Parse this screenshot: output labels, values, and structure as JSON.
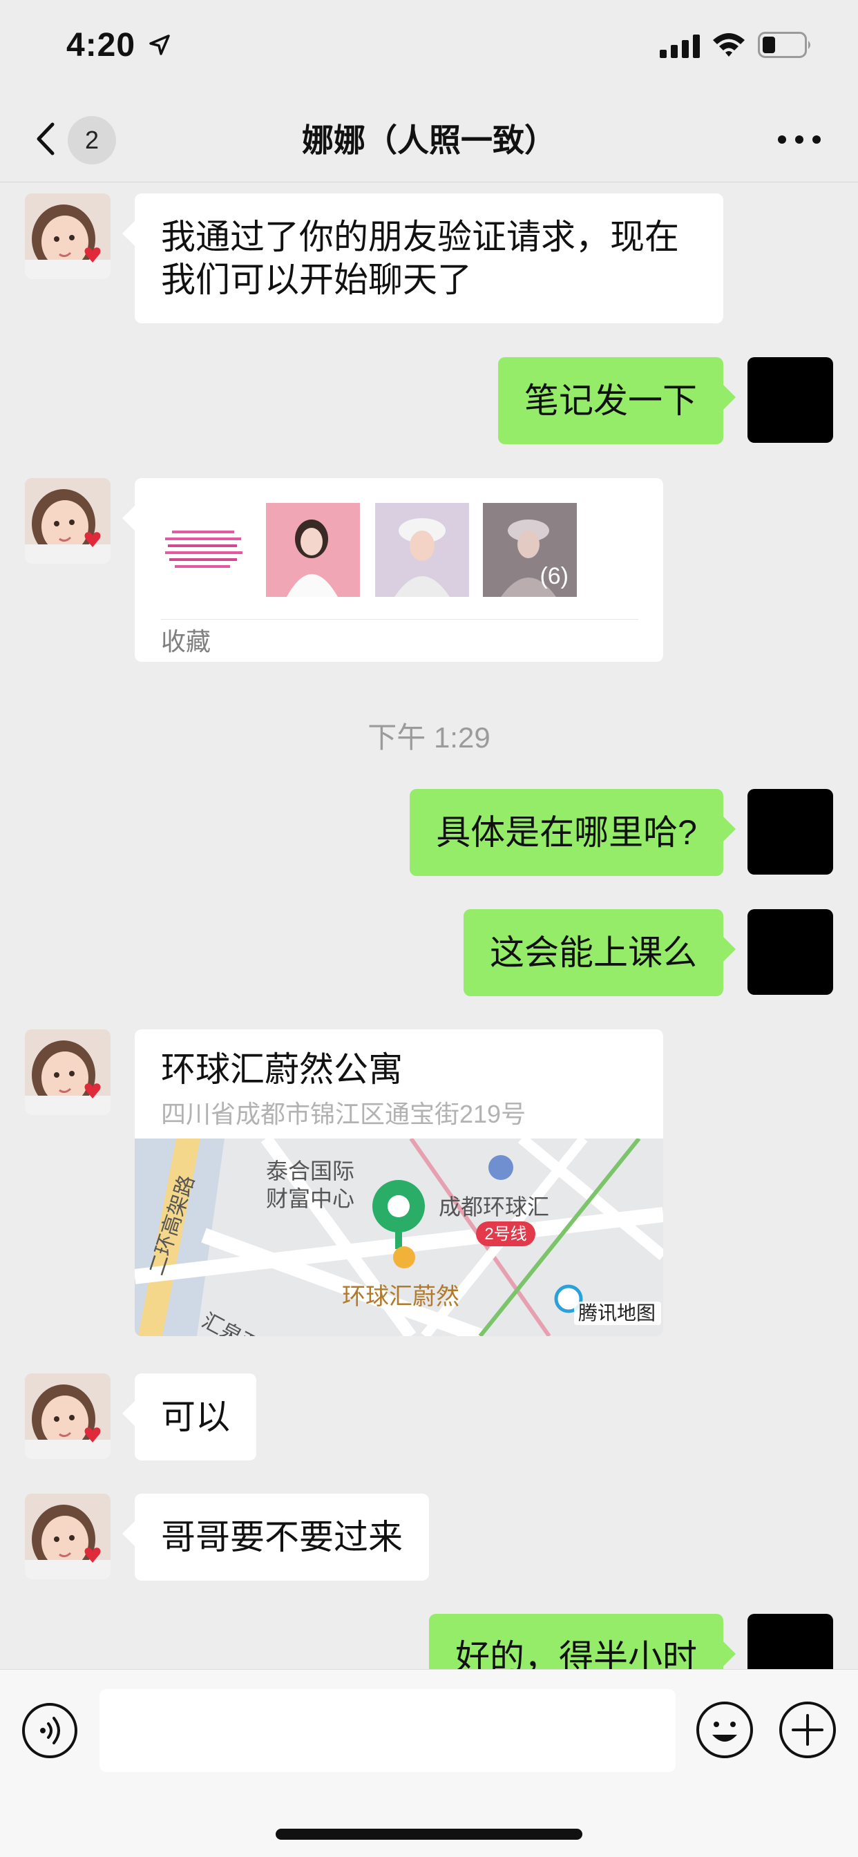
{
  "status_bar": {
    "time": "4:20",
    "icons": [
      "location-arrow-icon",
      "cellular-signal-icon",
      "wifi-icon",
      "battery-icon"
    ]
  },
  "nav": {
    "back_icon": "chevron-left-icon",
    "unread_count": "2",
    "title": "娜娜（人照一致）",
    "more_icon": "more-dots-icon"
  },
  "messages": {
    "m1": {
      "direction": "incoming",
      "text": "我通过了你的朋友验证请求，现在我们可以开始聊天了"
    },
    "m2": {
      "direction": "outgoing",
      "text": "笔记发一下"
    },
    "m3": {
      "direction": "incoming",
      "type": "favorites-card",
      "thumb_count": "(6)",
      "label": "收藏"
    },
    "time_separator": "下午 1:29",
    "m4": {
      "direction": "outgoing",
      "text": "具体是在哪里哈?"
    },
    "m5": {
      "direction": "outgoing",
      "text": "这会能上课么"
    },
    "m6": {
      "direction": "incoming",
      "type": "location-card",
      "title": "环球汇蔚然公寓",
      "address": "四川省成都市锦江区通宝街219号",
      "map_labels": {
        "poi1": "泰合国际",
        "poi1b": "财富中心",
        "poi2": "成都环球汇",
        "line": "2号线",
        "pin": "环球汇蔚然",
        "road1": "二环高架路",
        "road2": "汇泉西路",
        "brand": "腾讯地图"
      }
    },
    "m7": {
      "direction": "incoming",
      "text": "可以"
    },
    "m8": {
      "direction": "incoming",
      "text": "哥哥要不要过来"
    },
    "m9": {
      "direction": "outgoing",
      "text": "好的，得半小时"
    }
  },
  "colors": {
    "background": "#ededed",
    "outgoing_bubble": "#95ec69",
    "incoming_bubble": "#ffffff",
    "pin_green": "#2aae67"
  },
  "input_bar": {
    "voice_icon": "voice-icon",
    "emoji_icon": "emoji-icon",
    "plus_icon": "plus-icon"
  }
}
